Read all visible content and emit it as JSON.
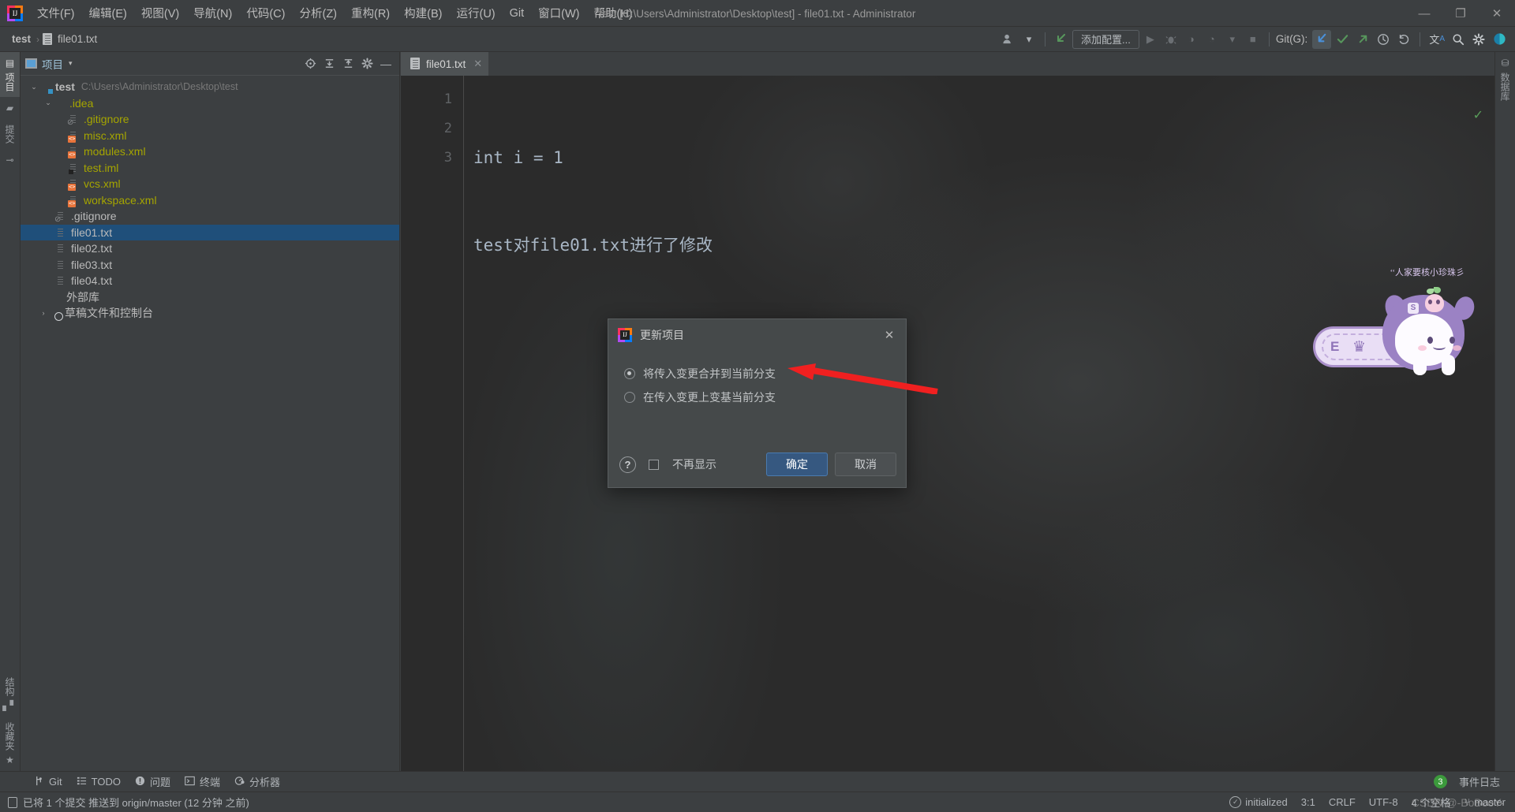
{
  "window": {
    "title": "test [C:\\Users\\Administrator\\Desktop\\test] - file01.txt - Administrator",
    "minimize": "—",
    "maximize": "❐",
    "close": "✕"
  },
  "menubar": {
    "items": [
      {
        "label": "文件(F)",
        "name": "menu-file"
      },
      {
        "label": "编辑(E)",
        "name": "menu-edit"
      },
      {
        "label": "视图(V)",
        "name": "menu-view"
      },
      {
        "label": "导航(N)",
        "name": "menu-navigate"
      },
      {
        "label": "代码(C)",
        "name": "menu-code"
      },
      {
        "label": "分析(Z)",
        "name": "menu-analyze"
      },
      {
        "label": "重构(R)",
        "name": "menu-refactor"
      },
      {
        "label": "构建(B)",
        "name": "menu-build"
      },
      {
        "label": "运行(U)",
        "name": "menu-run"
      },
      {
        "label": "Git",
        "name": "menu-git"
      },
      {
        "label": "窗口(W)",
        "name": "menu-window"
      },
      {
        "label": "帮助(H)",
        "name": "menu-help"
      }
    ]
  },
  "navbar": {
    "breadcrumbs": [
      {
        "label": "test"
      },
      {
        "label": "file01.txt"
      }
    ],
    "separator": "›",
    "run_config_placeholder": "添加配置...",
    "git_label": "Git(G):",
    "buttons": {
      "user_avatar": "👤",
      "dropdown_caret": "▾",
      "update_project": "↙",
      "run": "▶",
      "debug": "🐞",
      "run_coverage": "◑",
      "profile": "◔",
      "stop": "■",
      "git_update": "↙",
      "git_commit": "✓",
      "git_push": "↗",
      "git_history": "◷",
      "git_rollback": "↶",
      "translate": "文",
      "search": "🔍",
      "settings": "⚙",
      "ai_assistant": "◗"
    }
  },
  "left_stripe": {
    "items": [
      {
        "label": "项目",
        "icon": "project-icon",
        "selected": true
      },
      {
        "label": "提交",
        "icon": "commit-icon",
        "selected": false
      },
      {
        "label": "结构",
        "icon": "structure-icon",
        "selected": false
      }
    ],
    "bottom_items": [
      {
        "label": "结构",
        "icon": "structure-icon"
      },
      {
        "label": "收藏夹",
        "icon": "star-icon"
      }
    ]
  },
  "right_stripe": {
    "items": [
      {
        "label": "数据库",
        "icon": "database-icon"
      }
    ]
  },
  "project_panel": {
    "title": "项目",
    "caret": "▾",
    "icons": [
      {
        "name": "locate-icon",
        "glyph": "⊕"
      },
      {
        "name": "expand-all-icon",
        "glyph": "⩽"
      },
      {
        "name": "collapse-all-icon",
        "glyph": "⩾"
      },
      {
        "name": "settings-icon",
        "glyph": "⚙"
      },
      {
        "name": "hide-icon",
        "glyph": "—"
      }
    ],
    "tree": [
      {
        "label": "test",
        "sub": "C:\\Users\\Administrator\\Desktop\\test",
        "indent": 0,
        "twisty": "⌄",
        "icon": "folder-module-icon",
        "style": "bold",
        "selected": false
      },
      {
        "label": ".idea",
        "sub": "",
        "indent": 1,
        "twisty": "⌄",
        "icon": "folder-icon",
        "style": "ignored",
        "selected": false
      },
      {
        "label": ".gitignore",
        "sub": "",
        "indent": 2,
        "twisty": "",
        "icon": "file-gitignore-icon",
        "style": "ignored",
        "selected": false
      },
      {
        "label": "misc.xml",
        "sub": "",
        "indent": 2,
        "twisty": "",
        "icon": "file-xml-icon",
        "style": "ignored",
        "selected": false
      },
      {
        "label": "modules.xml",
        "sub": "",
        "indent": 2,
        "twisty": "",
        "icon": "file-xml-icon",
        "style": "ignored",
        "selected": false
      },
      {
        "label": "test.iml",
        "sub": "",
        "indent": 2,
        "twisty": "",
        "icon": "file-iml-icon",
        "style": "ignored",
        "selected": false
      },
      {
        "label": "vcs.xml",
        "sub": "",
        "indent": 2,
        "twisty": "",
        "icon": "file-xml-icon",
        "style": "ignored",
        "selected": false
      },
      {
        "label": "workspace.xml",
        "sub": "",
        "indent": 2,
        "twisty": "",
        "icon": "file-xml-icon",
        "style": "ignored",
        "selected": false
      },
      {
        "label": ".gitignore",
        "sub": "",
        "indent": 1,
        "twisty": "",
        "icon": "file-gitignore-icon",
        "style": "default",
        "selected": false
      },
      {
        "label": "file01.txt",
        "sub": "",
        "indent": 1,
        "twisty": "",
        "icon": "file-icon",
        "style": "default",
        "selected": true
      },
      {
        "label": "file02.txt",
        "sub": "",
        "indent": 1,
        "twisty": "",
        "icon": "file-icon",
        "style": "default",
        "selected": false
      },
      {
        "label": "file03.txt",
        "sub": "",
        "indent": 1,
        "twisty": "",
        "icon": "file-icon",
        "style": "default",
        "selected": false
      },
      {
        "label": "file04.txt",
        "sub": "",
        "indent": 1,
        "twisty": "",
        "icon": "file-icon",
        "style": "default",
        "selected": false
      },
      {
        "label": "外部库",
        "sub": "",
        "indent": 0,
        "twisty": "",
        "icon": "library-icon",
        "style": "default",
        "selected": false
      },
      {
        "label": "草稿文件和控制台",
        "sub": "",
        "indent": 0,
        "twisty": "›",
        "icon": "scratches-icon",
        "style": "default",
        "selected": false
      }
    ]
  },
  "editor": {
    "tab": {
      "label": "file01.txt",
      "close": "✕"
    },
    "lines": [
      "1",
      "2",
      "3"
    ],
    "code": [
      "int i = 1",
      "test对file01.txt进行了修改",
      ""
    ],
    "inspection_ok": "✓"
  },
  "sticker": {
    "caption": "‘‘人家要核小珍珠彡",
    "badge": "S"
  },
  "dialog": {
    "title": "更新项目",
    "close": "✕",
    "options": [
      {
        "label": "将传入变更合并到当前分支",
        "selected": true
      },
      {
        "label": "在传入变更上变基当前分支",
        "selected": false
      }
    ],
    "help": "?",
    "dont_show_again": "不再显示",
    "ok_label": "确定",
    "cancel_label": "取消"
  },
  "bottom_stripe": {
    "items": [
      {
        "label": "Git",
        "icon": "git-branch-icon"
      },
      {
        "label": "TODO",
        "icon": "todo-list-icon"
      },
      {
        "label": "问题",
        "icon": "problems-icon"
      },
      {
        "label": "终端",
        "icon": "terminal-icon"
      },
      {
        "label": "分析器",
        "icon": "profiler-icon"
      }
    ],
    "event_log": {
      "label": "事件日志",
      "count": "3"
    }
  },
  "statusbar": {
    "message": "已将 1 个提交 推送到 origin/master (12 分钟 之前)",
    "right": [
      {
        "label": "initialized",
        "icon": "check-circle-icon"
      },
      {
        "label": "3:1",
        "icon": ""
      },
      {
        "label": "CRLF",
        "icon": ""
      },
      {
        "label": "UTF-8",
        "icon": ""
      },
      {
        "label": "4 个空格",
        "icon": ""
      },
      {
        "label": "master",
        "icon": "branch-icon"
      }
    ]
  },
  "watermark": "CSDN @-BoBooY-",
  "colors": {
    "accent": "#365880",
    "selection": "#1f4f7a",
    "panel_bg": "#3c3f41",
    "editor_bg": "#2b2b2b",
    "ignored_text": "#a5a500",
    "arrow": "#f02020"
  }
}
